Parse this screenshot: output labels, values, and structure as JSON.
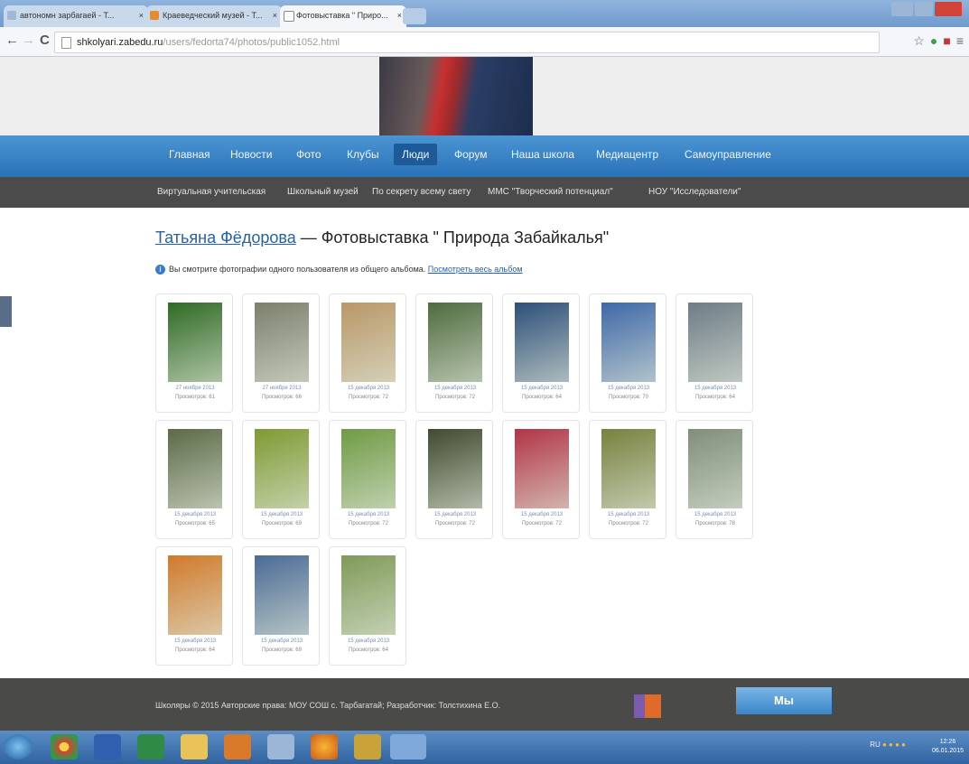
{
  "browser": {
    "tabs": [
      {
        "label": "автономн зарбагаей - Т..."
      },
      {
        "label": "Краеведческий музей - Т..."
      },
      {
        "label": "Фотовыставка \" Приро..."
      }
    ],
    "url_host": "shkolyari.zabedu.ru",
    "url_path": "/users/fedorta74/photos/public1052.html"
  },
  "main_nav": [
    "Главная",
    "Новости",
    "Фото",
    "Клубы",
    "Люди",
    "Форум",
    "Наша школа",
    "Медиацентр",
    "Самоуправление"
  ],
  "sub_nav": [
    "Виртуальная учительская",
    "Школьный музей",
    "По секрету всему свету",
    "ММС \"Творческий потенциал\"",
    "НОУ \"Исследователи\""
  ],
  "heading": {
    "author": "Татьяна Фёдорова",
    "dash": " — ",
    "title": "Фотовыставка \" Природа Забайкалья\""
  },
  "notice": {
    "text": "Вы смотрите фотографии одного пользователя из общего альбома.",
    "link": "Посмотреть весь альбом"
  },
  "photos": [
    {
      "date": "27 ноября 2013",
      "views": "Просмотров: 61"
    },
    {
      "date": "27 ноября 2013",
      "views": "Просмотров: 66"
    },
    {
      "date": "15 декабря 2013",
      "views": "Просмотров: 72"
    },
    {
      "date": "15 декабря 2013",
      "views": "Просмотров: 72"
    },
    {
      "date": "15 декабря 2013",
      "views": "Просмотров: 64"
    },
    {
      "date": "15 декабря 2013",
      "views": "Просмотров: 70"
    },
    {
      "date": "15 декабря 2013",
      "views": "Просмотров: 64"
    },
    {
      "date": "15 декабря 2013",
      "views": "Просмотров: 65"
    },
    {
      "date": "15 декабря 2013",
      "views": "Просмотров: 69"
    },
    {
      "date": "15 декабря 2013",
      "views": "Просмотров: 72"
    },
    {
      "date": "15 декабря 2013",
      "views": "Просмотров: 72"
    },
    {
      "date": "15 декабря 2013",
      "views": "Просмотров: 72"
    },
    {
      "date": "15 декабря 2013",
      "views": "Просмотров: 72"
    },
    {
      "date": "15 декабря 2013",
      "views": "Просмотров: 78"
    },
    {
      "date": "15 декабря 2013",
      "views": "Просмотров: 64"
    },
    {
      "date": "15 декабря 2013",
      "views": "Просмотров: 69"
    },
    {
      "date": "15 декабря 2013",
      "views": "Просмотров: 64"
    }
  ],
  "photo_colors": [
    "#2f6a24",
    "#7c7f6c",
    "#b99767",
    "#4f6b3f",
    "#2d4f7a",
    "#3e68a8",
    "#6d7c86",
    "#5c6a47",
    "#7e9a33",
    "#6f9a45",
    "#3f4a2e",
    "#b23445",
    "#77813f",
    "#7f8e7a",
    "#d07a2a",
    "#4a6b95",
    "#7f9a58"
  ],
  "footer": {
    "copyright": "Школяры © 2015 Авторские права: МОУ СОШ с. Тарбагатай; Разработчик: Толстихина Е.О.",
    "button": "Мы"
  },
  "taskbar": {
    "lang": "RU",
    "time": "12:26",
    "date": "06.01.2015"
  }
}
